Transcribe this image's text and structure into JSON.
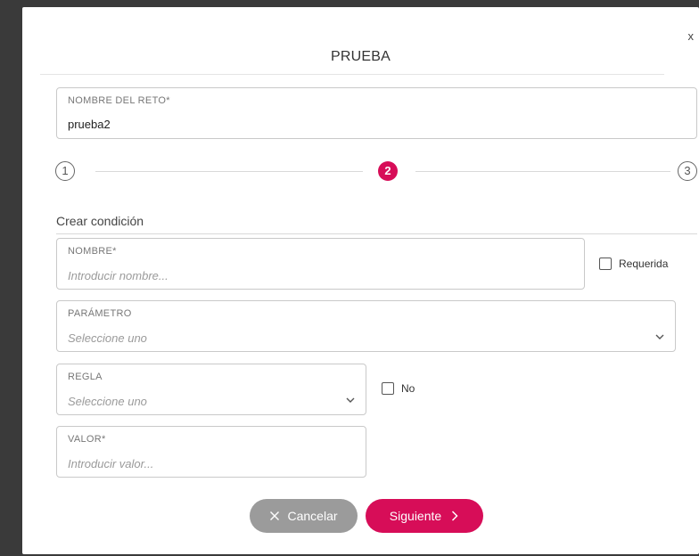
{
  "modal": {
    "title": "PRUEBA",
    "close_label": "x"
  },
  "challenge_name": {
    "label": "NOMBRE DEL RETO*",
    "value": "prueba2"
  },
  "stepper": {
    "steps": [
      "1",
      "2",
      "3"
    ],
    "active_step": 2
  },
  "section": {
    "title": "Crear condición"
  },
  "form": {
    "name": {
      "label": "NOMBRE*",
      "placeholder": "Introducir nombre..."
    },
    "required": {
      "label": "Requerida",
      "checked": false
    },
    "parameter": {
      "label": "PARÁMETRO",
      "placeholder": "Seleccione uno"
    },
    "rule": {
      "label": "REGLA",
      "placeholder": "Seleccione uno"
    },
    "negate": {
      "label": "No",
      "checked": false
    },
    "value": {
      "label": "VALOR*",
      "placeholder": "Introducir valor..."
    }
  },
  "actions": {
    "cancel_label": "Cancelar",
    "next_label": "Siguiente"
  },
  "colors": {
    "accent": "#d70d58",
    "cancel_bg": "#9b9b9b",
    "backdrop": "#3a3a3a"
  }
}
